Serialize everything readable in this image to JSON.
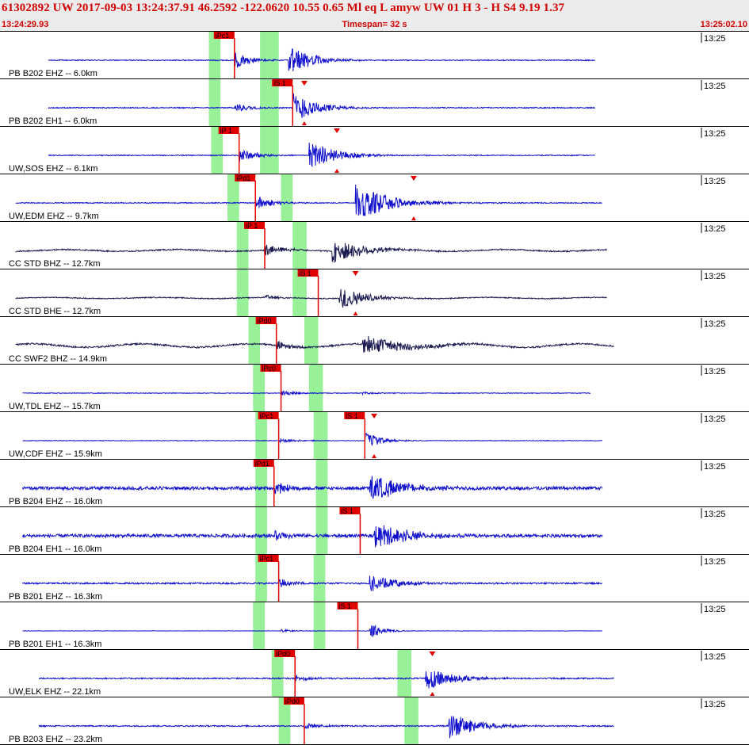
{
  "header": {
    "title": "61302892 UW 2017-09-03 13:24:37.91   46.2592 -122.0620  10.55  0.65 Ml  eq  L amyw     UW 01  H   3  -  H S4    9.19  1.37",
    "start_time": "13:24:29.93",
    "timespan": "Timespan=  32 s",
    "end_time": "13:25:02.10"
  },
  "colors": {
    "trace_short_period": "#1010cc",
    "trace_broadband": "#1a1a50",
    "pick": "#e00000",
    "window": "#98f098",
    "label": "#000000"
  },
  "chart_data": {
    "type": "line",
    "x_range": [
      29.93,
      62.1
    ],
    "x_unit": "s after 13:24",
    "right_tick_label": "13:25",
    "traces": [
      {
        "label": "PB B202 EHZ -- 6.0km",
        "start": 32.0,
        "end": 55.5,
        "p": 40.0,
        "s": 42.3,
        "amp": 1.0,
        "noise": 0.03,
        "coda": 3.5,
        "smax": 1.0,
        "color": "sp",
        "win1": [
          38.9,
          39.4
        ],
        "win2": [
          41.1,
          41.9
        ],
        "picks": [
          {
            "label": "iPc1",
            "t": 40.0
          }
        ],
        "marks": []
      },
      {
        "label": "PB B202 EH1 -- 6.0km",
        "start": 32.0,
        "end": 55.5,
        "p": 40.0,
        "s": 42.5,
        "amp": 0.55,
        "noise": 0.03,
        "coda": 3.5,
        "smax": 1.9,
        "color": "sp",
        "win1": [
          38.9,
          39.4
        ],
        "win2": [
          41.1,
          41.9
        ],
        "picks": [
          {
            "label": "iS 1",
            "t": 42.5
          }
        ],
        "marks": [
          43.0
        ]
      },
      {
        "label": "UW,SOS EHZ -- 6.1km",
        "start": 32.0,
        "end": 55.5,
        "p": 40.2,
        "s": 43.2,
        "amp": 0.8,
        "noise": 0.03,
        "coda": 4.0,
        "smax": 1.2,
        "color": "sp",
        "win1": [
          39.0,
          39.5
        ],
        "win2": [
          41.1,
          41.9
        ],
        "picks": [
          {
            "label": "iP 1",
            "t": 40.2
          }
        ],
        "marks": [
          44.4
        ]
      },
      {
        "label": "UW,EDM EHZ -- 9.7km",
        "start": 30.6,
        "end": 55.8,
        "p": 40.9,
        "s": 45.2,
        "amp": 0.9,
        "noise": 0.03,
        "coda": 5.0,
        "smax": 1.3,
        "color": "sp",
        "win1": [
          39.7,
          40.2
        ],
        "win2": [
          42.0,
          42.5
        ],
        "picks": [
          {
            "label": "iPd1",
            "t": 40.9
          }
        ],
        "marks": [
          47.7
        ]
      },
      {
        "label": "CC STD BHZ -- 12.7km",
        "start": 30.6,
        "end": 56.0,
        "p": 41.3,
        "s": 44.2,
        "amp": 0.7,
        "noise": 0.04,
        "coda": 4.5,
        "smax": 1.2,
        "color": "bb",
        "lowf": 0.09,
        "win1": [
          40.1,
          40.6
        ],
        "win2": [
          42.5,
          43.1
        ],
        "picks": [
          {
            "label": "iP 1",
            "t": 41.3
          }
        ],
        "marks": []
      },
      {
        "label": "CC STD BHE -- 12.7km",
        "start": 30.6,
        "end": 56.0,
        "p": 41.3,
        "s": 44.5,
        "amp": 0.3,
        "noise": 0.03,
        "coda": 4.0,
        "smax": 2.4,
        "color": "bb",
        "lowf": 0.06,
        "win1": [
          40.1,
          40.6
        ],
        "win2": [
          42.5,
          43.1
        ],
        "picks": [
          {
            "label": "iS 1",
            "t": 43.6
          }
        ],
        "marks": [
          45.2
        ]
      },
      {
        "label": "CC SWF2 BHZ -- 14.9km",
        "start": 30.6,
        "end": 56.3,
        "p": 41.8,
        "s": 45.5,
        "amp": 0.45,
        "noise": 0.05,
        "coda": 7.0,
        "smax": 1.3,
        "color": "bb",
        "lowf": 0.18,
        "win1": [
          40.6,
          41.1
        ],
        "win2": [
          43.0,
          43.6
        ],
        "picks": [
          {
            "label": "iPd0",
            "t": 41.8
          }
        ],
        "marks": []
      },
      {
        "label": "UW,TDL EHZ -- 15.7km",
        "start": 30.9,
        "end": 55.3,
        "p": 42.0,
        "s": 45.5,
        "amp": 0.3,
        "noise": 0.02,
        "coda": 2.5,
        "smax": 0.3,
        "color": "sp",
        "win1": [
          40.8,
          41.3
        ],
        "win2": [
          43.2,
          43.8
        ],
        "picks": [
          {
            "label": "iPc0",
            "t": 42.0
          }
        ],
        "marks": []
      },
      {
        "label": "UW,CDF EHZ -- 15.9km",
        "start": 30.9,
        "end": 55.8,
        "p": 41.9,
        "s": 45.6,
        "amp": 0.25,
        "noise": 0.02,
        "coda": 2.5,
        "smax": 2.2,
        "color": "sp",
        "win1": [
          40.9,
          41.4
        ],
        "win2": [
          43.4,
          44.0
        ],
        "picks": [
          {
            "label": "iPc1",
            "t": 41.9
          },
          {
            "label": "iS 1",
            "t": 45.6
          }
        ],
        "marks": [
          46.0
        ]
      },
      {
        "label": "PB B204 EHZ -- 16.0km",
        "start": 30.9,
        "end": 55.8,
        "p": 41.7,
        "s": 45.8,
        "amp": 0.7,
        "noise": 0.1,
        "coda": 5.0,
        "smax": 1.2,
        "color": "sp",
        "win1": [
          40.9,
          41.4
        ],
        "win2": [
          43.5,
          44.0
        ],
        "picks": [
          {
            "label": "iPd1",
            "t": 41.7
          }
        ],
        "marks": []
      },
      {
        "label": "PB B204 EH1 -- 16.0km",
        "start": 30.9,
        "end": 55.8,
        "p": 41.7,
        "s": 46.0,
        "amp": 0.55,
        "noise": 0.1,
        "coda": 5.0,
        "smax": 1.5,
        "color": "sp",
        "win1": [
          40.9,
          41.4
        ],
        "win2": [
          43.5,
          44.0
        ],
        "picks": [
          {
            "label": "iS 1",
            "t": 45.4
          }
        ],
        "marks": []
      },
      {
        "label": "PB B201 EHZ -- 16.3km",
        "start": 30.9,
        "end": 55.8,
        "p": 41.9,
        "s": 45.8,
        "amp": 0.5,
        "noise": 0.05,
        "coda": 4.0,
        "smax": 1.2,
        "color": "sp",
        "win1": [
          40.9,
          41.4
        ],
        "win2": [
          43.4,
          43.9
        ],
        "picks": [
          {
            "label": "iPc1",
            "t": 41.9
          }
        ],
        "marks": []
      },
      {
        "label": "PB B201 EH1 -- 16.3km",
        "start": 30.9,
        "end": 55.8,
        "p": 42.0,
        "s": 45.8,
        "amp": 0.2,
        "noise": 0.01,
        "coda": 2.0,
        "smax": 2.5,
        "color": "sp",
        "win1": [
          40.8,
          41.3
        ],
        "win2": [
          43.4,
          43.9
        ],
        "picks": [
          {
            "label": "iS 1",
            "t": 45.3
          }
        ],
        "marks": []
      },
      {
        "label": "UW,ELK EHZ -- 22.1km",
        "start": 31.6,
        "end": 56.3,
        "p": 42.6,
        "s": 48.2,
        "amp": 0.35,
        "noise": 0.04,
        "coda": 4.0,
        "smax": 2.2,
        "color": "sp",
        "win1": [
          41.6,
          42.1
        ],
        "win2": [
          47.0,
          47.6
        ],
        "picks": [
          {
            "label": "iPd0",
            "t": 42.6
          }
        ],
        "marks": [
          48.5
        ]
      },
      {
        "label": "PB B203 EHZ -- 23.2km",
        "start": 31.6,
        "end": 56.3,
        "p": 43.0,
        "s": 49.2,
        "amp": 0.4,
        "noise": 0.04,
        "coda": 4.0,
        "smax": 2.2,
        "color": "sp",
        "win1": [
          41.9,
          42.4
        ],
        "win2": [
          47.3,
          47.9
        ],
        "picks": [
          {
            "label": "iPd0",
            "t": 43.0
          }
        ],
        "marks": []
      }
    ]
  }
}
